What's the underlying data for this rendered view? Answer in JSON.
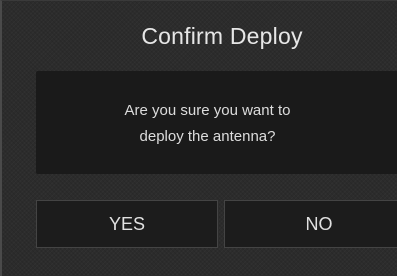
{
  "dialog": {
    "title": "Confirm Deploy",
    "message_line1": "Are you sure you want to",
    "message_line2": "deploy the antenna?",
    "yes_label": "YES",
    "no_label": "NO"
  }
}
